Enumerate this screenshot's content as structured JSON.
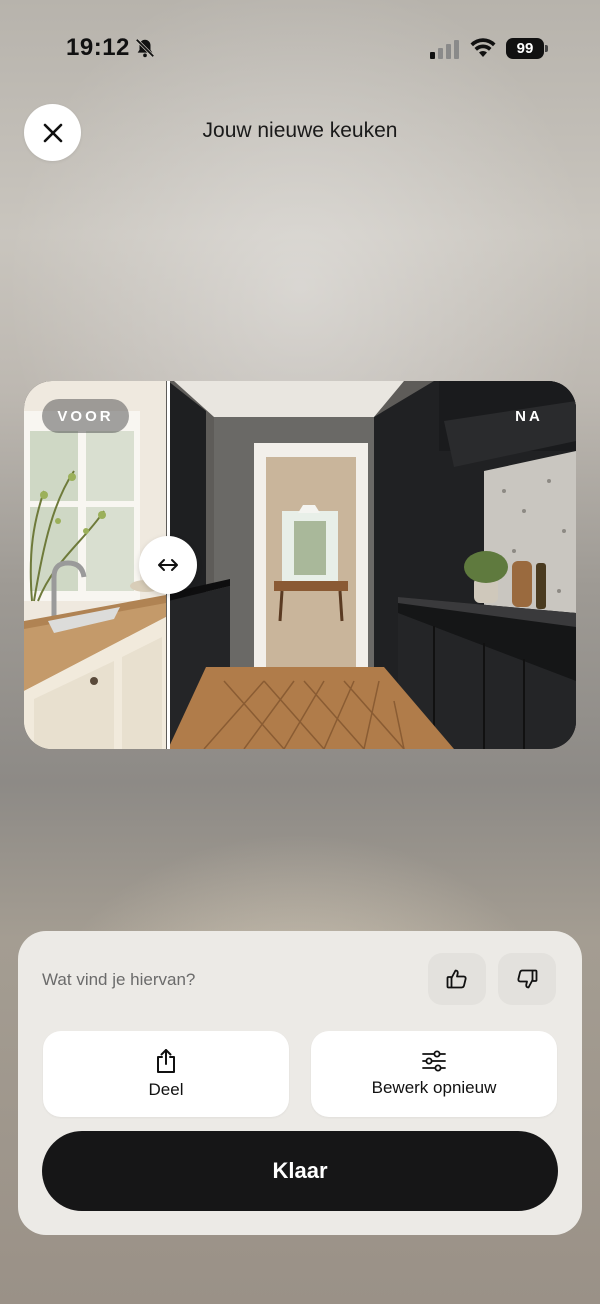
{
  "status_bar": {
    "time": "19:12",
    "battery": "99",
    "icons": [
      "bell-slash-icon",
      "cellular-signal-icon",
      "wifi-icon",
      "battery-icon"
    ]
  },
  "header": {
    "title": "Jouw nieuwe keuken",
    "close_icon": "close-icon"
  },
  "comparison": {
    "before_label": "VOOR",
    "after_label": "NA",
    "slider_position": 0.26,
    "handle_icon": "left-right-arrows-icon"
  },
  "feedback": {
    "question": "Wat vind je hiervan?",
    "like_icon": "thumbs-up-icon",
    "dislike_icon": "thumbs-down-icon"
  },
  "actions": {
    "share_label": "Deel",
    "share_icon": "share-icon",
    "edit_label": "Bewerk opnieuw",
    "edit_icon": "sliders-icon",
    "done_label": "Klaar"
  },
  "colors": {
    "primary_button": "#161617",
    "sheet_background": "#eceae6",
    "card_background": "#ffffff"
  }
}
